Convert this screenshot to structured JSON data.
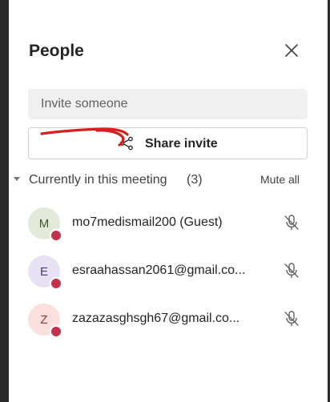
{
  "panel": {
    "title": "People"
  },
  "invite": {
    "placeholder": "Invite someone"
  },
  "share_button": {
    "label": "Share invite",
    "icon": "share-icon"
  },
  "section": {
    "label": "Currently in this meeting",
    "count": "(3)",
    "mute_all_label": "Mute all"
  },
  "participants": [
    {
      "initial": "M",
      "name": "mo7medismail200 (Guest)",
      "avatar_bg": "#e3ead9",
      "avatar_fg": "#3f5a2a",
      "status_color": "#c4314b",
      "mic_icon": "mic-off-icon"
    },
    {
      "initial": "E",
      "name": "esraahassan2061@gmail.co...",
      "avatar_bg": "#e6e1f3",
      "avatar_fg": "#463a7a",
      "status_color": "#c4314b",
      "mic_icon": "mic-off-icon"
    },
    {
      "initial": "Z",
      "name": "zazazasghsgh67@gmail.co...",
      "avatar_bg": "#fbe0dd",
      "avatar_fg": "#8a3a30",
      "status_color": "#c4314b",
      "mic_icon": "mic-off-icon"
    }
  ],
  "colors": {
    "status_dot": "#c4314b",
    "annotation_scribble": "#d81e1e",
    "text": "#242424"
  }
}
